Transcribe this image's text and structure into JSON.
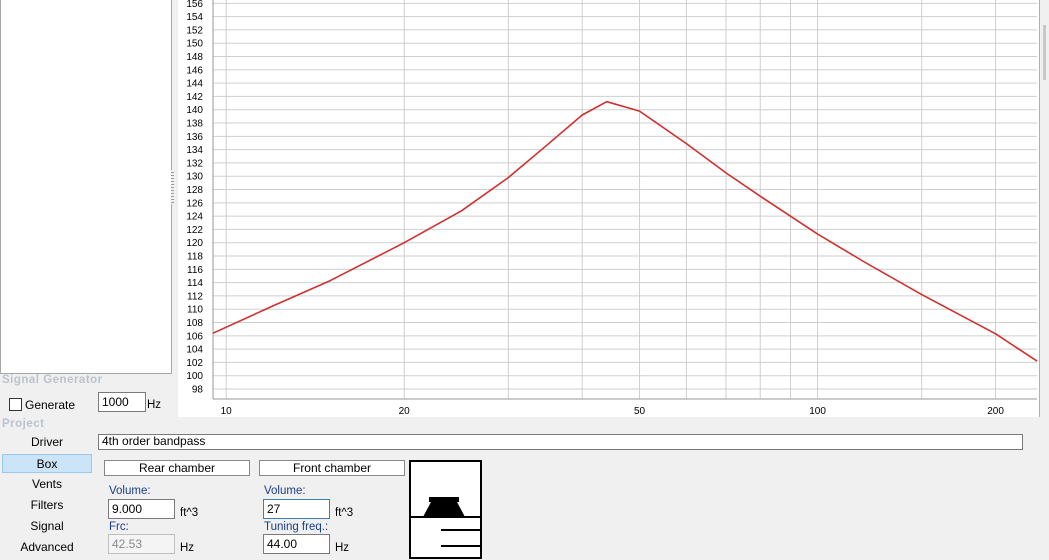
{
  "signal_generator": {
    "title": "Signal Generator",
    "generate_label": "Generate",
    "generate_checked": false,
    "frequency_value": "1000",
    "frequency_unit": "Hz"
  },
  "project": {
    "title": "Project",
    "nav": [
      {
        "label": "Driver",
        "selected": false
      },
      {
        "label": "Box",
        "selected": true
      },
      {
        "label": "Vents",
        "selected": false
      },
      {
        "label": "Filters",
        "selected": false
      },
      {
        "label": "Signal",
        "selected": false
      },
      {
        "label": "Advanced",
        "selected": false
      }
    ]
  },
  "box": {
    "description": "4th order bandpass",
    "rear_chamber": {
      "tab_label": "Rear chamber",
      "volume_label": "Volume:",
      "volume_value": "9.000",
      "volume_unit": "ft^3",
      "frc_label": "Frc:",
      "frc_value": "42.53",
      "frc_unit": "Hz"
    },
    "front_chamber": {
      "tab_label": "Front chamber",
      "volume_label": "Volume:",
      "volume_value": "27",
      "volume_unit": "ft^3",
      "tuning_label": "Tuning freq.:",
      "tuning_value": "44.00",
      "tuning_unit": "Hz"
    }
  },
  "chart_data": {
    "type": "line",
    "xscale": "log",
    "xlim": [
      9.5,
      235
    ],
    "ylim": [
      96.5,
      156.5
    ],
    "y_ticks": [
      98,
      100,
      102,
      104,
      106,
      108,
      110,
      112,
      114,
      116,
      118,
      120,
      122,
      124,
      126,
      128,
      130,
      132,
      134,
      136,
      138,
      140,
      142,
      144,
      146,
      148,
      150,
      152,
      154,
      156
    ],
    "x_ticks": [
      10,
      20,
      50,
      100,
      200
    ],
    "x_minor": [
      30,
      40,
      60,
      70,
      80,
      90,
      150
    ],
    "grid": true,
    "line_color": "#d03030",
    "series": [
      {
        "x": [
          9.5,
          12,
          15,
          20,
          25,
          30,
          35,
          40,
          44,
          50,
          60,
          70,
          80,
          100,
          120,
          150,
          200,
          235
        ],
        "y": [
          106.4,
          110.5,
          114.3,
          120,
          124.8,
          129.8,
          134.8,
          139.2,
          141.2,
          139.8,
          134.9,
          130.5,
          127,
          121.3,
          117.1,
          112.2,
          106.3,
          102.2
        ]
      }
    ]
  }
}
